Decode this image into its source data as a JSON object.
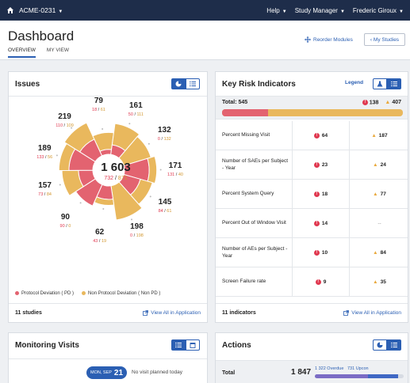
{
  "topbar": {
    "org": "ACME-0231",
    "help": "Help",
    "role": "Study Manager",
    "user": "Frederic Giroux"
  },
  "page": {
    "title": "Dashboard",
    "tabs": [
      "OVERVIEW",
      "MY VIEW"
    ],
    "reorder": "Reorder Modules",
    "my_studies": "My Studies"
  },
  "issues": {
    "title": "Issues",
    "center_total": "1 603",
    "center_pd": "732",
    "center_npd": "871",
    "segments": [
      {
        "total": "79",
        "pd": "18",
        "npd": "61"
      },
      {
        "total": "161",
        "pd": "50",
        "npd": "111"
      },
      {
        "total": "132",
        "pd": "0",
        "npd": "132"
      },
      {
        "total": "171",
        "pd": "131",
        "npd": "40"
      },
      {
        "total": "145",
        "pd": "84",
        "npd": "61"
      },
      {
        "total": "198",
        "pd": "0",
        "npd": "198"
      },
      {
        "total": "62",
        "pd": "43",
        "npd": "19"
      },
      {
        "total": "90",
        "pd": "90",
        "npd": "0"
      },
      {
        "total": "157",
        "pd": "73",
        "npd": "84"
      },
      {
        "total": "189",
        "pd": "133",
        "npd": "56"
      },
      {
        "total": "219",
        "pd": "110",
        "npd": "109"
      }
    ],
    "legend_pd": "Protocol Deviation ( PD )",
    "legend_npd": "Non Protocol Deviation ( Non PD )",
    "footer_count": "11 studies",
    "footer_link": "View All in Application",
    "colors": {
      "pd": "#e36370",
      "npd": "#e9b85d"
    }
  },
  "kri": {
    "title": "Key Risk Indicators",
    "legend_link": "Legend",
    "total_label": "Total: 545",
    "total_red": "138",
    "total_amber": "407",
    "total_red_fraction": 0.253,
    "rows": [
      {
        "name": "Percent Missing Visit",
        "red": "64",
        "amber": "187"
      },
      {
        "name": "Number of SAEs per Subject - Year",
        "red": "23",
        "amber": "24"
      },
      {
        "name": "Percent System Query",
        "red": "18",
        "amber": "77"
      },
      {
        "name": "Percent Out of Window Visit",
        "red": "14",
        "amber": "--"
      },
      {
        "name": "Number of AEs per Subject - Year",
        "red": "10",
        "amber": "84"
      },
      {
        "name": "Screen Failure rate",
        "red": "9",
        "amber": "35"
      }
    ],
    "footer_count": "11 indicators",
    "footer_link": "View All in Application"
  },
  "monitoring": {
    "title": "Monitoring Visits",
    "date_label": "MON, SEP",
    "date_day": "21",
    "no_visit": "No visit planned today"
  },
  "actions": {
    "title": "Actions",
    "total_label": "Total",
    "total_value": "1 847",
    "overdue": "1 322 Overdue",
    "upcoming": "731 Upcon"
  }
}
